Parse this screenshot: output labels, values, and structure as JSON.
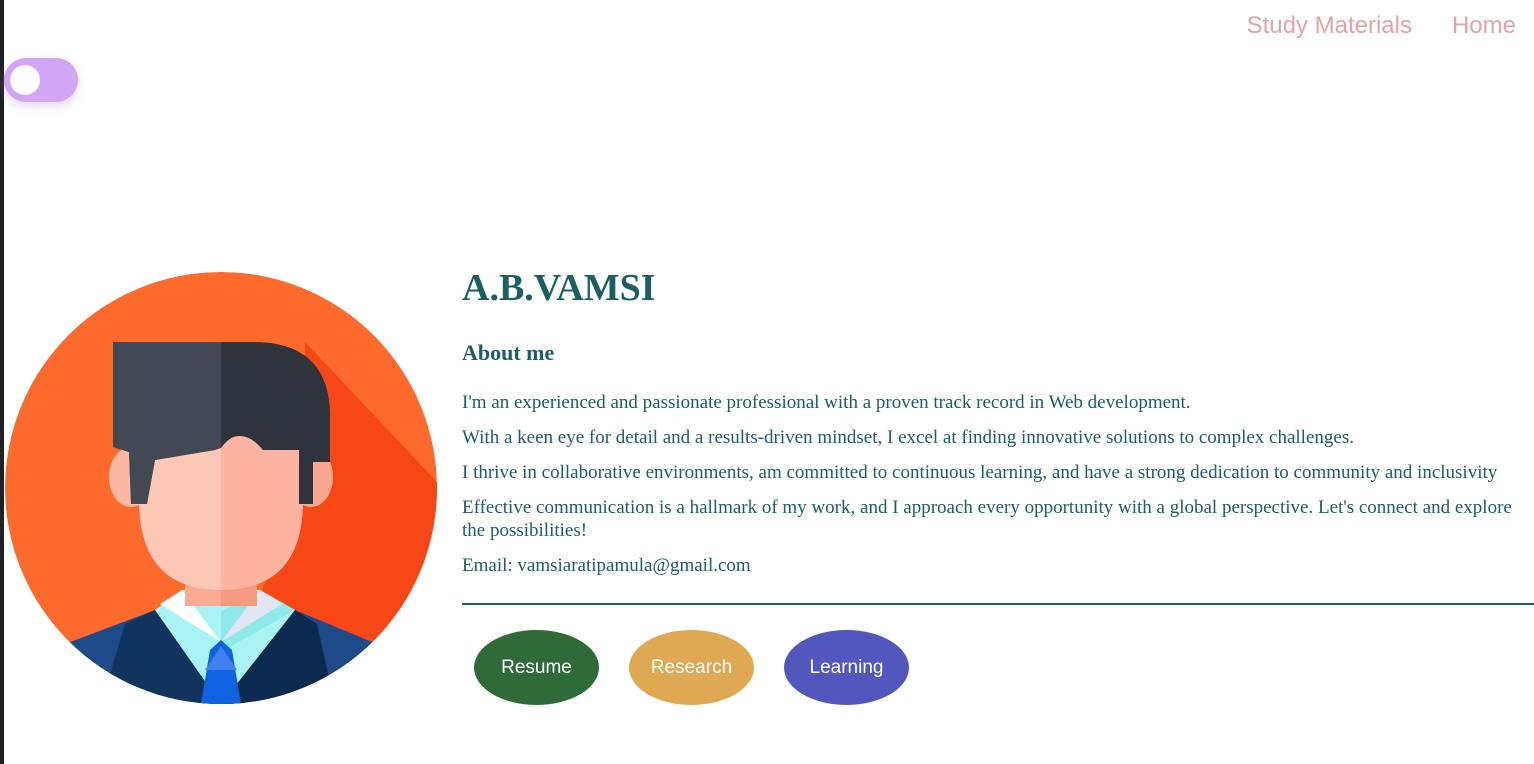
{
  "nav": {
    "items": [
      {
        "label": "Study Materials"
      },
      {
        "label": "Home"
      }
    ]
  },
  "theme_toggle": {
    "state": "off",
    "color": "#d2a6f5"
  },
  "avatar": {
    "icon": "man-avatar-icon",
    "background_color": "#fb6a2b"
  },
  "profile": {
    "name": "A.B.VAMSI",
    "about_title": "About me",
    "paragraphs": [
      "I'm an experienced and passionate professional with a proven track record in Web development.",
      "With a keen eye for detail and a results-driven mindset, I excel at finding innovative solutions to complex challenges.",
      "I thrive in collaborative environments, am committed to continuous learning, and have a strong dedication to community and inclusivity",
      "Effective communication is a hallmark of my work, and I approach every opportunity with a global perspective. Let's connect and explore the possibilities!",
      "Email: vamsiaratipamula@gmail.com"
    ],
    "text_color": "#1c5f63"
  },
  "buttons": [
    {
      "label": "Resume",
      "color": "#2f6a38"
    },
    {
      "label": "Research",
      "color": "#dfa852"
    },
    {
      "label": "Learning",
      "color": "#5157bd"
    }
  ]
}
